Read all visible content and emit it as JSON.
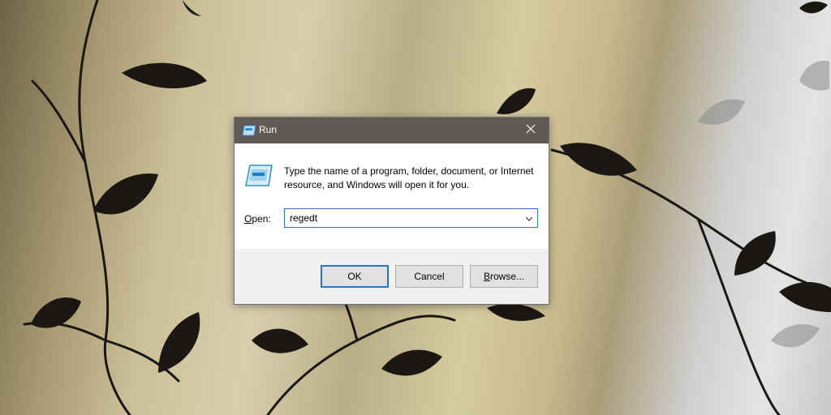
{
  "dialog": {
    "title": "Run",
    "description": "Type the name of a program, folder, document, or Internet resource, and Windows will open it for you.",
    "open_label_prefix": "O",
    "open_label_rest": "pen:",
    "open_value": "regedt",
    "ok_label": "OK",
    "cancel_label": "Cancel",
    "browse_label_prefix": "B",
    "browse_label_rest": "rowse..."
  },
  "colors": {
    "titlebar": "#5f5a55",
    "focus_accent": "#2b73c7",
    "button_face": "#e1e1e1",
    "dialog_footer": "#f0f0f0"
  },
  "icons": {
    "title": "run-app-icon",
    "close": "close-icon",
    "body": "run-app-icon",
    "dropdown": "chevron-down-icon"
  }
}
